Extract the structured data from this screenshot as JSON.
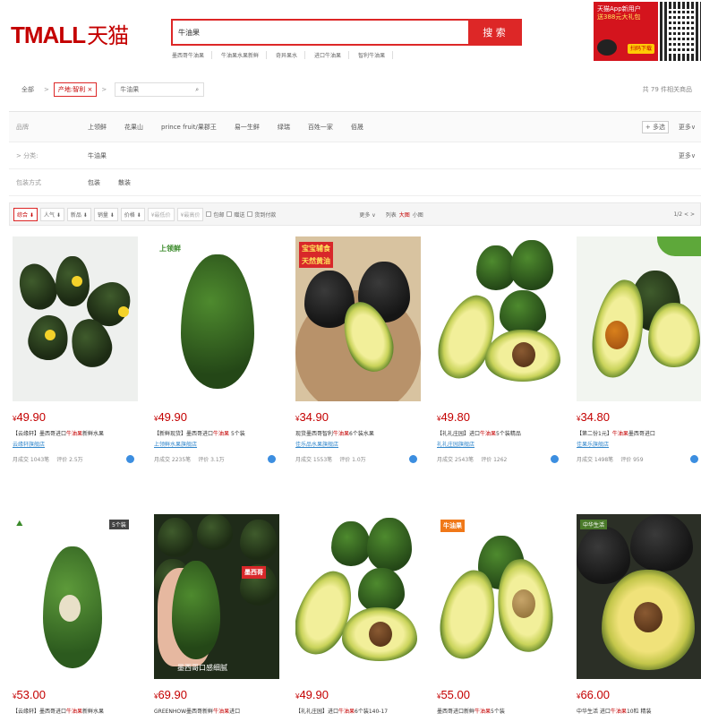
{
  "header": {
    "logo_latin": "TMALL",
    "logo_cn": "天猫",
    "search_value": "牛油果",
    "search_button": "搜 索",
    "hot_words": [
      "墨西哥牛油果",
      "牛油果水果新鲜",
      "奇异果水",
      "进口牛油果",
      "智利牛油果"
    ],
    "promo_line1": "天猫App新用户",
    "promo_line2": "送388元大礼包",
    "promo_download": "扫码下载"
  },
  "breadcrumb": {
    "all": "全部",
    "category_tag": "产地:智利 ×",
    "query": "牛油果",
    "result_count": "共 79 件相关商品"
  },
  "filters": {
    "brand_label": "品牌",
    "brands": [
      "上领鲜",
      "花果山",
      "prince fruit/果郡王",
      "易一生鲜",
      "绿瑞",
      "百姓一家",
      "佰晟"
    ],
    "multi_select": "+ 多选",
    "more": "更多∨",
    "category_label": "> 分类:",
    "category_value": "牛油果",
    "category_more": "更多∨",
    "pack_label": "包装方式",
    "packs": [
      "包装",
      "散装"
    ]
  },
  "sortbar": {
    "items": [
      "综合 ⬇",
      "人气 ⬇",
      "新品 ⬇",
      "销量 ⬇",
      "价格 ⬇"
    ],
    "price_placeholder": "¥最低价",
    "price_placeholder2": "¥最高价",
    "checks": [
      "包邮",
      "赠送",
      "货到付款"
    ],
    "more": "更多 ∨",
    "views": [
      "列表",
      "大图",
      "小图"
    ],
    "page": "1/2 < >"
  },
  "products": [
    {
      "price": "49.90",
      "title_pre": "【云缘轩】墨西哥进口",
      "title_hl": "牛油果",
      "title_post": "新鲜水果",
      "shop": "云缘轩旗舰店",
      "sales": "月成交 1043笔",
      "reviews": "评价 2.5万"
    },
    {
      "price": "49.90",
      "title_pre": "【新鲜现货】墨西哥进口",
      "title_hl": "牛油果",
      "title_post": " 5个装",
      "shop": "上领鲜水果旗舰店",
      "sales": "月成交 2235笔",
      "reviews": "评价 3.1万"
    },
    {
      "price": "34.90",
      "title_pre": "现货墨西哥智利",
      "title_hl": "牛油果",
      "title_post": "6个装水果",
      "shop": "佳乐品水果旗舰店",
      "sales": "月成交 1553笔",
      "reviews": "评价 1.0万"
    },
    {
      "price": "49.80",
      "title_pre": "【礼礼庄园】进口",
      "title_hl": "牛油果",
      "title_post": "5个装精品",
      "shop": "礼礼庄园旗舰店",
      "sales": "月成交 2543笔",
      "reviews": "评价 1262"
    },
    {
      "price": "34.80",
      "title_pre": "【第二份1元】",
      "title_hl": "牛油果",
      "title_post": "墨西哥进口",
      "shop": "佳果乐旗舰店",
      "sales": "月成交 1498笔",
      "reviews": "评价 959"
    },
    {
      "price": "53.00",
      "title_pre": "【云缘轩】墨西哥进口",
      "title_hl": "牛油果",
      "title_post": "新鲜水果",
      "shop": "",
      "sales": "",
      "reviews": ""
    },
    {
      "price": "69.90",
      "title_pre": "GREENHOW墨西哥新鲜",
      "title_hl": "牛油果",
      "title_post": "进口",
      "shop": "",
      "sales": "",
      "reviews": ""
    },
    {
      "price": "49.90",
      "title_pre": "【礼礼庄园】进口",
      "title_hl": "牛油果",
      "title_post": "6个装140-17",
      "shop": "",
      "sales": "",
      "reviews": ""
    },
    {
      "price": "55.00",
      "title_pre": "墨西哥进口新鲜",
      "title_hl": "牛油果",
      "title_post": "5个装",
      "shop": "",
      "sales": "",
      "reviews": ""
    },
    {
      "price": "66.00",
      "title_pre": "中华生活 进口",
      "title_hl": "牛油果",
      "title_post": "10粒 精装",
      "shop": "",
      "sales": "",
      "reviews": ""
    }
  ],
  "image_labels": {
    "p2_brand": "上领鲜",
    "p3_badge1": "宝宝辅食",
    "p3_badge2": "天然黄油",
    "p6_weight": "5个装",
    "p7_badge": "墨西哥",
    "p7_caption": "墨西哥口感细腻",
    "p9_badge": "牛油果",
    "p10_badge": "中华生活"
  }
}
